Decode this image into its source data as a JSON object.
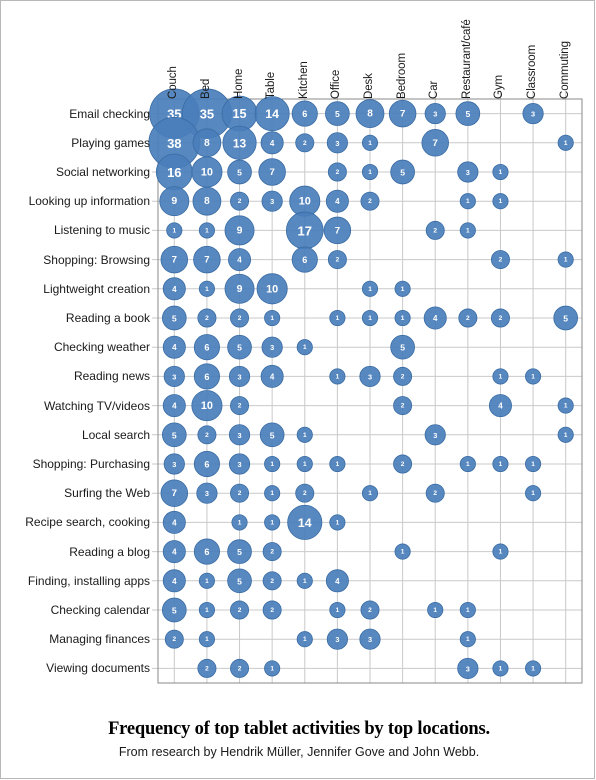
{
  "caption": {
    "title": "Frequency of top tablet activities by top locations.",
    "subtitle": "From research by Hendrik Müller, Jennifer Gove and John Webb."
  },
  "style": {
    "bubble_color": "#4A7EBB",
    "bubble_stroke": "#3A6CA4",
    "grid_color": "#c9c9c9",
    "axis_color": "#8a8a8a",
    "label_color": "#1a1a1a",
    "value_color": "#ffffff",
    "frame_color": "#b8b8b8"
  },
  "chart_data": {
    "type": "heatmap",
    "title": "Frequency of top tablet activities by top locations.",
    "subtitle": "From research by Hendrik Müller, Jennifer Gove and John Webb.",
    "xlabel": "",
    "ylabel": "",
    "grid": true,
    "legend": "none",
    "value_range": [
      1,
      38
    ],
    "categories": [
      "Couch",
      "Bed",
      "Home",
      "Table",
      "Kitchen",
      "Office",
      "Desk",
      "Bedroom",
      "Car",
      "Restaurant/café",
      "Gym",
      "Classroom",
      "Commuting"
    ],
    "rows": [
      "Email checking",
      "Playing games",
      "Social networking",
      "Looking up information",
      "Listening to music",
      "Shopping: Browsing",
      "Lightweight creation",
      "Reading a book",
      "Checking weather",
      "Reading news",
      "Watching TV/videos",
      "Local search",
      "Shopping: Purchasing",
      "Surfing the Web",
      "Recipe search, cooking",
      "Reading a blog",
      "Finding, installing apps",
      "Checking calendar",
      "Managing finances",
      "Viewing documents"
    ],
    "series": [
      {
        "name": "Email checking",
        "values": [
          35,
          35,
          15,
          14,
          6,
          5,
          8,
          7,
          3,
          5,
          0,
          3,
          0
        ]
      },
      {
        "name": "Playing games",
        "values": [
          38,
          8,
          13,
          4,
          2,
          3,
          1,
          0,
          7,
          0,
          0,
          0,
          1
        ]
      },
      {
        "name": "Social networking",
        "values": [
          16,
          10,
          5,
          7,
          0,
          2,
          1,
          5,
          0,
          3,
          1,
          0,
          0
        ]
      },
      {
        "name": "Looking up information",
        "values": [
          9,
          8,
          2,
          3,
          10,
          4,
          2,
          0,
          0,
          1,
          1,
          0,
          0
        ]
      },
      {
        "name": "Listening to music",
        "values": [
          1,
          1,
          9,
          0,
          17,
          7,
          0,
          0,
          2,
          1,
          0,
          0,
          0
        ]
      },
      {
        "name": "Shopping: Browsing",
        "values": [
          7,
          7,
          4,
          0,
          6,
          2,
          0,
          0,
          0,
          0,
          2,
          0,
          1
        ]
      },
      {
        "name": "Lightweight creation",
        "values": [
          4,
          1,
          9,
          10,
          0,
          0,
          1,
          1,
          0,
          0,
          0,
          0,
          0
        ]
      },
      {
        "name": "Reading a book",
        "values": [
          5,
          2,
          2,
          1,
          0,
          1,
          1,
          1,
          4,
          2,
          2,
          0,
          5
        ]
      },
      {
        "name": "Checking weather",
        "values": [
          4,
          6,
          5,
          3,
          1,
          0,
          0,
          5,
          0,
          0,
          0,
          0,
          0
        ]
      },
      {
        "name": "Reading news",
        "values": [
          3,
          6,
          3,
          4,
          0,
          1,
          3,
          2,
          0,
          0,
          1,
          1,
          0
        ]
      },
      {
        "name": "Watching TV/videos",
        "values": [
          4,
          10,
          2,
          0,
          0,
          0,
          0,
          2,
          0,
          0,
          4,
          0,
          1
        ]
      },
      {
        "name": "Local search",
        "values": [
          5,
          2,
          3,
          5,
          1,
          0,
          0,
          0,
          3,
          0,
          0,
          0,
          1
        ]
      },
      {
        "name": "Shopping: Purchasing",
        "values": [
          3,
          6,
          3,
          1,
          1,
          1,
          0,
          2,
          0,
          1,
          1,
          1,
          0
        ]
      },
      {
        "name": "Surfing the Web",
        "values": [
          7,
          3,
          2,
          1,
          2,
          0,
          1,
          0,
          2,
          0,
          0,
          1,
          0
        ]
      },
      {
        "name": "Recipe search, cooking",
        "values": [
          4,
          0,
          1,
          1,
          14,
          1,
          0,
          0,
          0,
          0,
          0,
          0,
          0
        ]
      },
      {
        "name": "Reading a blog",
        "values": [
          4,
          6,
          5,
          2,
          0,
          0,
          0,
          1,
          0,
          0,
          1,
          0,
          0
        ]
      },
      {
        "name": "Finding, installing apps",
        "values": [
          4,
          1,
          5,
          2,
          1,
          4,
          0,
          0,
          0,
          0,
          0,
          0,
          0
        ]
      },
      {
        "name": "Checking calendar",
        "values": [
          5,
          1,
          2,
          2,
          0,
          1,
          2,
          0,
          1,
          1,
          0,
          0,
          0
        ]
      },
      {
        "name": "Managing finances",
        "values": [
          2,
          1,
          0,
          0,
          1,
          3,
          3,
          0,
          0,
          1,
          0,
          0,
          0
        ]
      },
      {
        "name": "Viewing documents",
        "values": [
          0,
          2,
          2,
          1,
          0,
          0,
          0,
          0,
          0,
          3,
          1,
          1,
          0
        ]
      }
    ]
  }
}
